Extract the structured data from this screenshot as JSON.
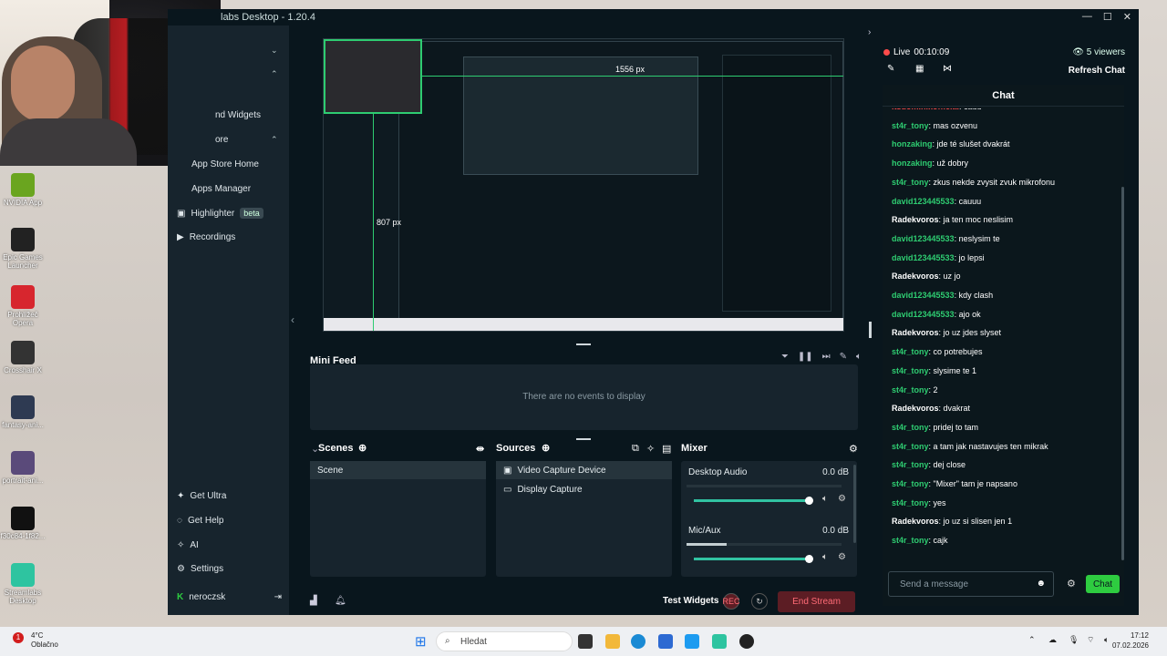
{
  "app": {
    "title": "labs Desktop - 1.20.4"
  },
  "sidebar": {
    "items": [
      {
        "label": "nd Widgets"
      },
      {
        "label": "ore"
      },
      {
        "label": "App Store Home"
      },
      {
        "label": "Apps Manager"
      },
      {
        "label": "Highlighter",
        "badge": "beta"
      },
      {
        "label": "Recordings"
      }
    ],
    "bottom": [
      {
        "label": "Get Ultra"
      },
      {
        "label": "Get Help"
      },
      {
        "label": "AI"
      },
      {
        "label": "Settings"
      }
    ],
    "user": "neroczsk"
  },
  "preview": {
    "measure_w": "1556 px",
    "measure_h": "807 px"
  },
  "minifeed": {
    "title": "Mini Feed",
    "empty": "There are no events to display"
  },
  "scenes": {
    "title": "Scenes",
    "items": [
      "Scene"
    ]
  },
  "sources": {
    "title": "Sources",
    "items": [
      "Video Capture Device",
      "Display Capture"
    ]
  },
  "mixer": {
    "title": "Mixer",
    "channels": [
      {
        "name": "Desktop Audio",
        "db": "0.0 dB",
        "level": 0.97
      },
      {
        "name": "Mic/Aux",
        "db": "0.0 dB",
        "level": 0.97
      }
    ]
  },
  "bottombar": {
    "test_widgets": "Test Widgets",
    "end_stream": "End Stream"
  },
  "live": {
    "status": "Live",
    "time": "00:10:09",
    "viewers": "5 viewers",
    "refresh": "Refresh Chat"
  },
  "chat": {
    "title": "Chat",
    "placeholder": "Send a message",
    "button": "Chat",
    "messages": [
      {
        "user": "itsdominikofficial",
        "text": ": cauu",
        "color": "#ff4b4b"
      },
      {
        "user": "st4r_tony",
        "text": ": mas ozvenu",
        "color": "#2ecc71"
      },
      {
        "user": "honzaking",
        "text": ": jde té slušet dvakrát",
        "color": "#2ecc71"
      },
      {
        "user": "honzaking",
        "text": ": už dobry",
        "color": "#2ecc71"
      },
      {
        "user": "st4r_tony",
        "text": ": zkus nekde zvysit zvuk mikrofonu",
        "color": "#2ecc71"
      },
      {
        "user": "david123445533",
        "text": ": cauuu",
        "color": "#2ecc71"
      },
      {
        "user": "Radekvoros",
        "text": ": ja ten moc neslisim",
        "color": "#ffffff"
      },
      {
        "user": "david123445533",
        "text": ": neslysim te",
        "color": "#2ecc71"
      },
      {
        "user": "david123445533",
        "text": ": jo lepsi",
        "color": "#2ecc71"
      },
      {
        "user": "Radekvoros",
        "text": ": uz jo",
        "color": "#ffffff"
      },
      {
        "user": "david123445533",
        "text": ": kdy clash",
        "color": "#2ecc71"
      },
      {
        "user": "david123445533",
        "text": ": ajo ok",
        "color": "#2ecc71"
      },
      {
        "user": "Radekvoros",
        "text": ": jo uz jdes slyset",
        "color": "#ffffff"
      },
      {
        "user": "st4r_tony",
        "text": ": co potrebujes",
        "color": "#2ecc71"
      },
      {
        "user": "st4r_tony",
        "text": ": slysime te 1",
        "color": "#2ecc71"
      },
      {
        "user": "st4r_tony",
        "text": ": 2",
        "color": "#2ecc71"
      },
      {
        "user": "Radekvoros",
        "text": ": dvakrat",
        "color": "#ffffff"
      },
      {
        "user": "st4r_tony",
        "text": ": pridej to tam",
        "color": "#2ecc71"
      },
      {
        "user": "st4r_tony",
        "text": ": a tam jak nastavujes ten mikrak",
        "color": "#2ecc71"
      },
      {
        "user": "st4r_tony",
        "text": ": dej close",
        "color": "#2ecc71"
      },
      {
        "user": "st4r_tony",
        "text": ": \"Mixer\" tam je napsano",
        "color": "#2ecc71"
      },
      {
        "user": "st4r_tony",
        "text": ": yes",
        "color": "#2ecc71"
      },
      {
        "user": "Radekvoros",
        "text": ": jo uz si slisen jen 1",
        "color": "#ffffff"
      },
      {
        "user": "st4r_tony",
        "text": ": cajk",
        "color": "#2ecc71"
      }
    ]
  },
  "desktop": {
    "icons": [
      {
        "label": "NVIDIA App",
        "color": "#6aa51f"
      },
      {
        "label": "Epic Games Launcher",
        "color": "#222222"
      },
      {
        "label": "Prohlížeč Opera",
        "color": "#d7262e"
      },
      {
        "label": "Crosshair X",
        "color": "#333333"
      },
      {
        "label": "fantasy-ani...",
        "color": "#2e3a52"
      },
      {
        "label": "portrait-ani...",
        "color": "#5a4a7a"
      },
      {
        "label": "f30c84-1f82...",
        "color": "#111111"
      },
      {
        "label": "Streamlabs Desktop",
        "color": "#2ec4a0"
      }
    ]
  },
  "taskbar": {
    "search": "Hledat",
    "weather_temp": "4°C",
    "weather_desc": "Oblačno",
    "time": "17:12",
    "date": "07.02.2026"
  }
}
